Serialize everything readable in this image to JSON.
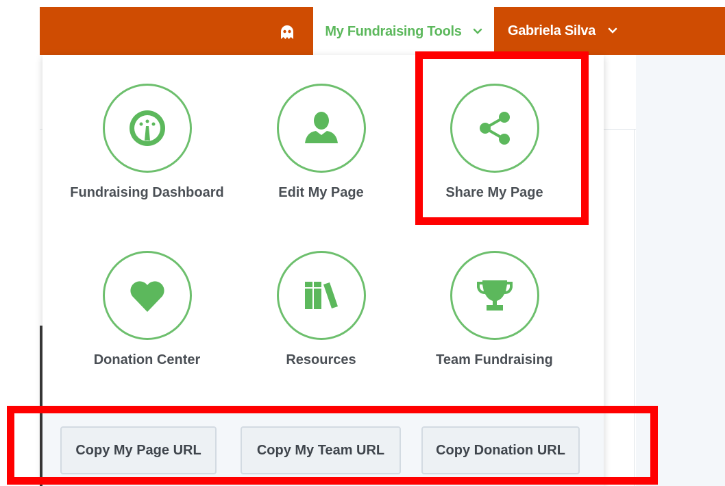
{
  "nav": {
    "tools_label": "My Fundraising Tools",
    "user_label": "Gabriela Silva"
  },
  "tiles": [
    {
      "label": "Fundraising Dashboard",
      "icon": "dashboard-gauge-icon"
    },
    {
      "label": "Edit My Page",
      "icon": "user-icon"
    },
    {
      "label": "Share My Page",
      "icon": "share-icon"
    },
    {
      "label": "Donation Center",
      "icon": "heart-icon"
    },
    {
      "label": "Resources",
      "icon": "books-icon"
    },
    {
      "label": "Team Fundraising",
      "icon": "trophy-icon"
    }
  ],
  "copy_buttons": [
    {
      "label": "Copy My Page URL"
    },
    {
      "label": "Copy My Team URL"
    },
    {
      "label": "Copy Donation URL"
    }
  ],
  "colors": {
    "navbar": "#cf4c02",
    "accent_green": "#5cb85c",
    "highlight": "#ff0000"
  }
}
